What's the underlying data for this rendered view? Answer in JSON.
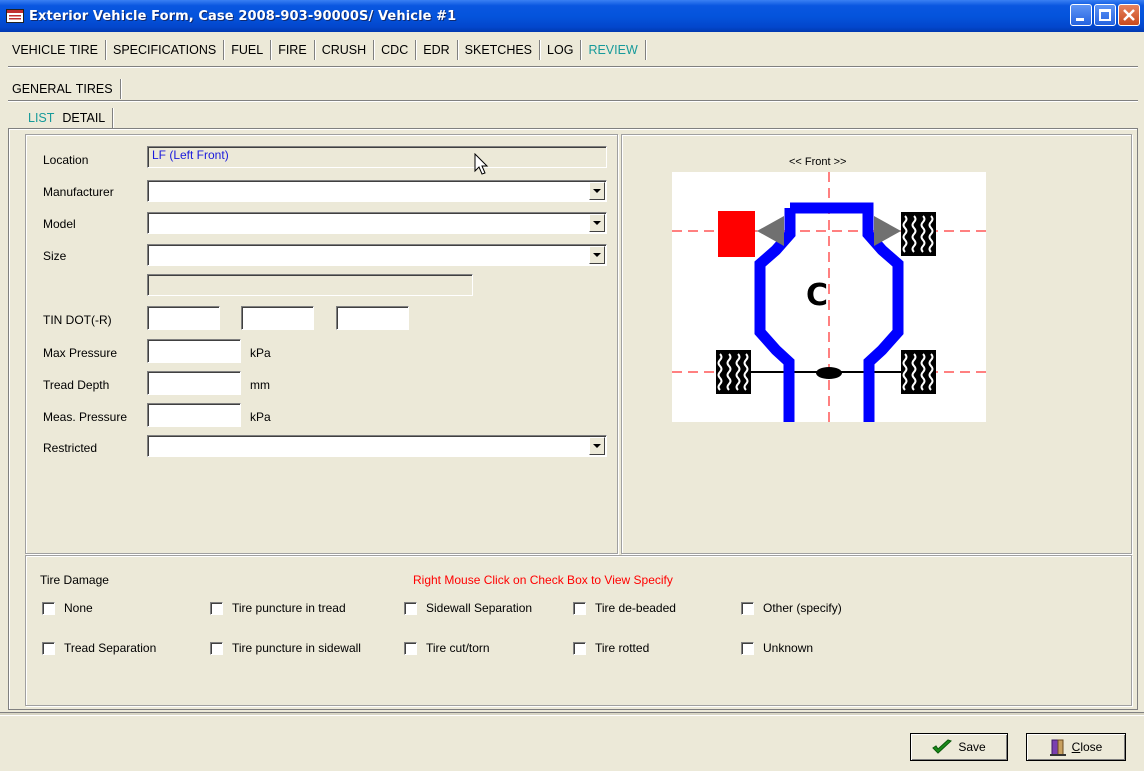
{
  "window": {
    "title": "Exterior Vehicle Form, Case 2008-903-90000S/ Vehicle #1"
  },
  "tabs_main": [
    {
      "label": "VEHICLE"
    },
    {
      "label": "TIRE"
    },
    {
      "label": "SPECIFICATIONS"
    },
    {
      "label": "FUEL"
    },
    {
      "label": "FIRE"
    },
    {
      "label": "CRUSH"
    },
    {
      "label": "CDC"
    },
    {
      "label": "EDR"
    },
    {
      "label": "SKETCHES"
    },
    {
      "label": "LOG"
    },
    {
      "label": "REVIEW"
    }
  ],
  "tabs_sub": [
    {
      "label": "GENERAL"
    },
    {
      "label": "TIRES"
    }
  ],
  "tabs_view": [
    {
      "label": "LIST"
    },
    {
      "label": "DETAIL"
    }
  ],
  "form": {
    "location_label": "Location",
    "location_value": "LF (Left Front)",
    "manufacturer_label": "Manufacturer",
    "manufacturer_value": "",
    "model_label": "Model",
    "model_value": "",
    "size_label": "Size",
    "size_value": "",
    "tin_label": "TIN DOT(-R)",
    "max_pressure_label": "Max Pressure",
    "max_pressure_unit": "kPa",
    "tread_depth_label": "Tread Depth",
    "tread_depth_unit": "mm",
    "meas_pressure_label": "Meas. Pressure",
    "meas_pressure_unit": "kPa",
    "restricted_label": "Restricted",
    "restricted_value": ""
  },
  "diagram": {
    "front_label": "<< Front >>",
    "center_letter": "C",
    "selected_tire_color": "#ff0000",
    "frame_color": "#0000ff",
    "axis_line_color": "#ff0000"
  },
  "damage": {
    "title": "Tire Damage",
    "hint": "Right Mouse Click on Check Box  to View Specify",
    "hint_color": "#ff0000",
    "options": [
      {
        "label": "None",
        "checked": false
      },
      {
        "label": "Tire puncture in tread",
        "checked": false
      },
      {
        "label": "Sidewall Separation",
        "checked": false
      },
      {
        "label": "Tire de-beaded",
        "checked": false
      },
      {
        "label": "Other (specify)",
        "checked": false
      },
      {
        "label": "Tread Separation",
        "checked": false
      },
      {
        "label": "Tire puncture in sidewall",
        "checked": false
      },
      {
        "label": "Tire cut/torn",
        "checked": false
      },
      {
        "label": "Tire rotted",
        "checked": false
      },
      {
        "label": "Unknown",
        "checked": false
      }
    ]
  },
  "buttons": {
    "save": "Save",
    "close_first": "C",
    "close_rest": "lose"
  }
}
